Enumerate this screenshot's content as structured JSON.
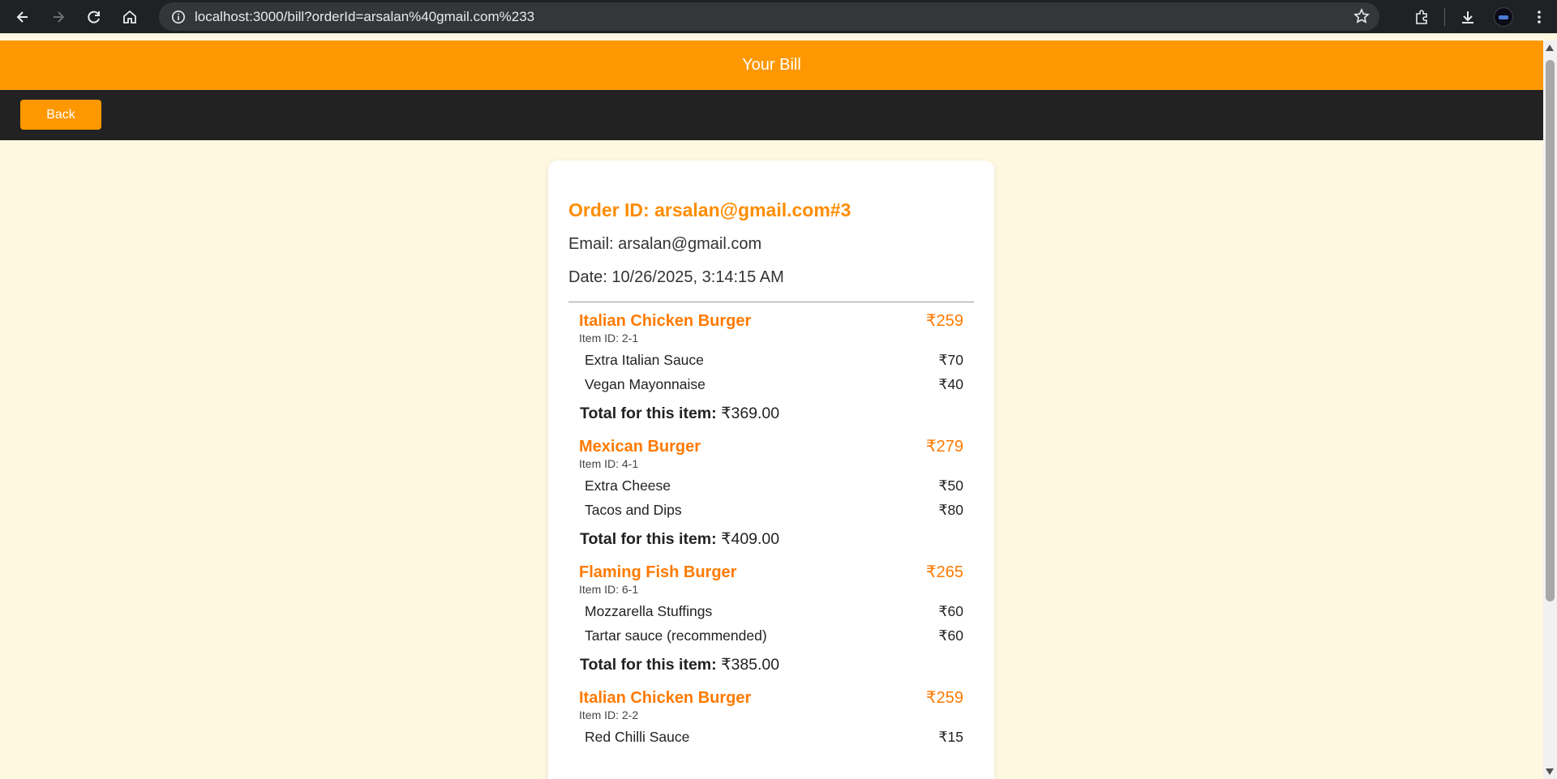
{
  "browser": {
    "url": "localhost:3000/bill?orderId=arsalan%40gmail.com%233"
  },
  "header": {
    "title": "Your Bill"
  },
  "toolbar": {
    "back_label": "Back"
  },
  "bill": {
    "order_id": "Order ID: arsalan@gmail.com#3",
    "email": "Email: arsalan@gmail.com",
    "date": "Date: 10/26/2025, 3:14:15 AM",
    "total_label": "Total for this item:",
    "items": [
      {
        "name": "Italian Chicken Burger",
        "price": "₹259",
        "item_id": "Item ID: 2-1",
        "addons": [
          {
            "name": "Extra Italian Sauce",
            "price": "₹70"
          },
          {
            "name": "Vegan Mayonnaise",
            "price": "₹40"
          }
        ],
        "total": "₹369.00"
      },
      {
        "name": "Mexican Burger",
        "price": "₹279",
        "item_id": "Item ID: 4-1",
        "addons": [
          {
            "name": "Extra Cheese",
            "price": "₹50"
          },
          {
            "name": "Tacos and Dips",
            "price": "₹80"
          }
        ],
        "total": "₹409.00"
      },
      {
        "name": "Flaming Fish Burger",
        "price": "₹265",
        "item_id": "Item ID: 6-1",
        "addons": [
          {
            "name": "Mozzarella Stuffings",
            "price": "₹60"
          },
          {
            "name": "Tartar sauce (recommended)",
            "price": "₹60"
          }
        ],
        "total": "₹385.00"
      },
      {
        "name": "Italian Chicken Burger",
        "price": "₹259",
        "item_id": "Item ID: 2-2",
        "addons": [
          {
            "name": "Red Chilli Sauce",
            "price": "₹15"
          }
        ]
      }
    ]
  },
  "colors": {
    "accent": "#ff9800",
    "item_name": "#ff7a00",
    "toolbar_bg": "#222222",
    "page_bg": "#fff8e1"
  }
}
